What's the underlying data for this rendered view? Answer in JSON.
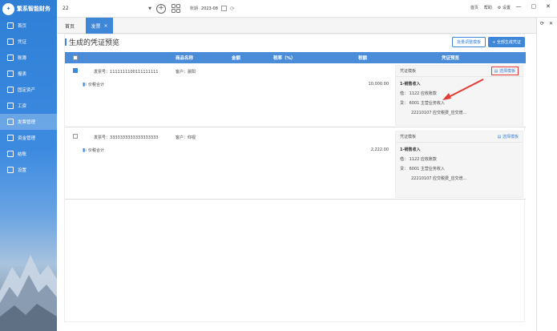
{
  "app": {
    "logo_text": "繁系智能财务"
  },
  "sidebar": {
    "items": [
      {
        "label": "首页"
      },
      {
        "label": "凭证"
      },
      {
        "label": "账簿"
      },
      {
        "label": "报表"
      },
      {
        "label": "固定资产"
      },
      {
        "label": "工资"
      },
      {
        "label": "发票管理"
      },
      {
        "label": "资金管理"
      },
      {
        "label": "结账"
      },
      {
        "label": "设置"
      }
    ],
    "active_index": 6
  },
  "topbar": {
    "company_value": "22",
    "period_label": "账期",
    "period_value": "2023-08",
    "links": [
      "首页",
      "帮助",
      "设置"
    ]
  },
  "window": {
    "minimize": "—",
    "restore": "▢",
    "close": "✕"
  },
  "tabs": [
    {
      "label": "首页"
    },
    {
      "label": "发票",
      "close": "×"
    }
  ],
  "strip": {
    "refresh": "⟳",
    "close": "✕"
  },
  "page": {
    "title": "生成的凭证预览",
    "template_button": "批量调整模板",
    "generate_button": "+ 全部生成凭证"
  },
  "table": {
    "headers": [
      "商品名称",
      "金额",
      "税率（%）",
      "税额",
      "凭证预览"
    ],
    "rows": [
      {
        "invoice_label": "发票号：",
        "invoice_no": "1111111100111111111",
        "customer_label": "客户：",
        "customer": "晨阳",
        "subtotal_label": "价税合计",
        "amount": "10,000.00",
        "voucher": {
          "title": "凭证模板",
          "select": "选择模板",
          "summary": "1-销售收入",
          "lines": [
            {
              "dir": "借：",
              "text": "1122 应收账款"
            },
            {
              "dir": "贷：",
              "text": "6001 主营业务收入"
            },
            {
              "dir": "",
              "text": "22210107 应交税费_应交增..."
            }
          ]
        }
      },
      {
        "invoice_label": "发票号：",
        "invoice_no": "3333333333333333333",
        "customer_label": "客户：",
        "customer": "仰视",
        "subtotal_label": "价税合计",
        "amount": "2,222.00",
        "voucher": {
          "title": "凭证模板",
          "select": "选择模板",
          "summary": "1-销售收入",
          "lines": [
            {
              "dir": "借：",
              "text": "1122 应收账款"
            },
            {
              "dir": "贷：",
              "text": "6001 主营业务收入"
            },
            {
              "dir": "",
              "text": "22210107 应交税费_应交增..."
            }
          ]
        }
      }
    ]
  },
  "colors": {
    "primary": "#3d86d8",
    "highlight": "#e53935"
  }
}
